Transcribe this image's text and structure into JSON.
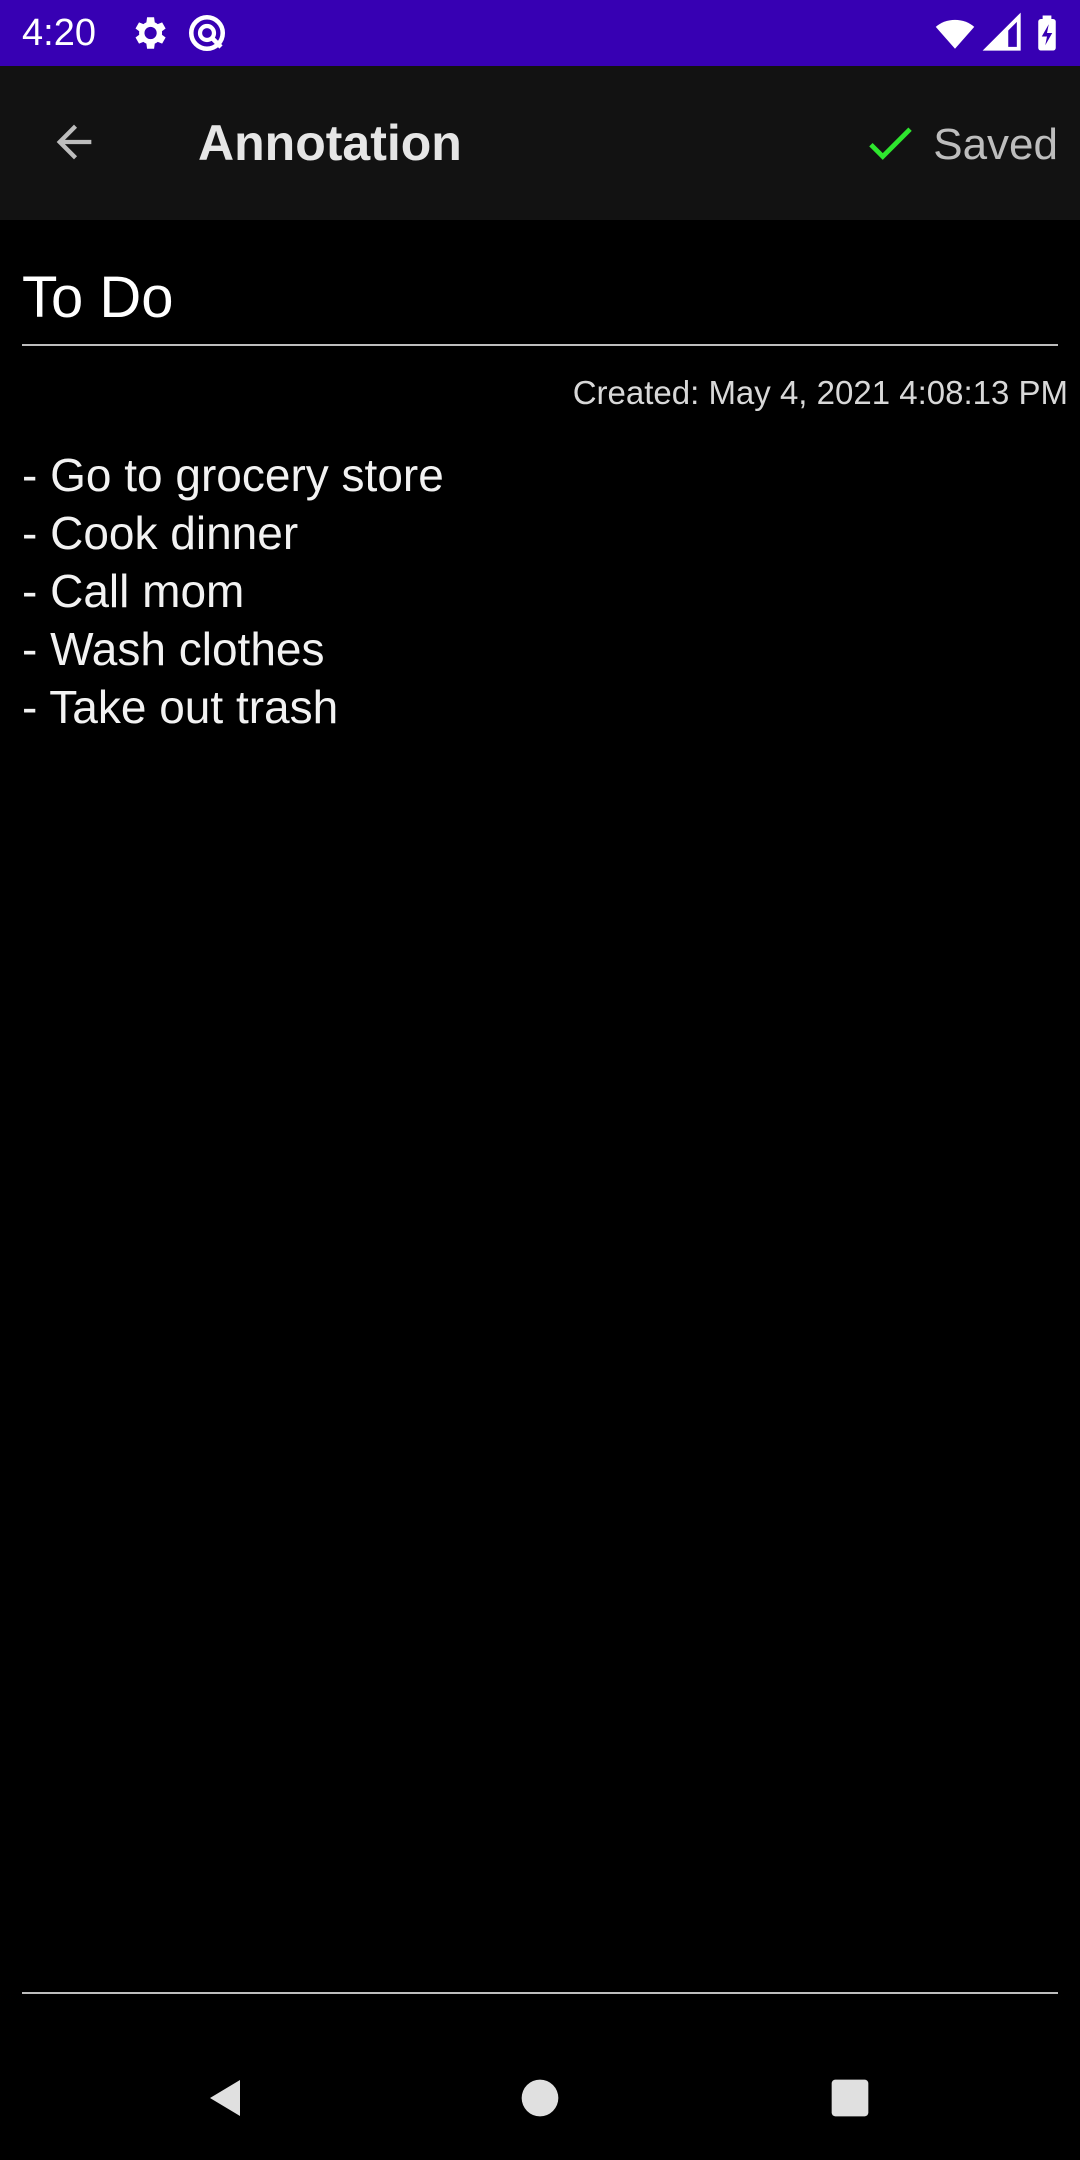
{
  "status_bar": {
    "time": "4:20",
    "left_icons": [
      "settings-gear-icon",
      "data-saver-icon"
    ],
    "right_icons": [
      "wifi-icon",
      "cell-signal-icon",
      "battery-charging-icon"
    ],
    "background_color": "#3700b3"
  },
  "app_bar": {
    "back_icon": "arrow-back-icon",
    "title": "Annotation",
    "saved_icon": "check-icon",
    "saved_label": "Saved",
    "check_color": "#2ee62e"
  },
  "note": {
    "title": "To Do",
    "created": "Created: May 4, 2021 4:08:13 PM",
    "lines": [
      "- Go to grocery store",
      "- Cook dinner",
      "- Call mom",
      "- Wash clothes",
      "- Take out trash"
    ]
  },
  "nav_bar": {
    "icons": [
      "nav-back-icon",
      "nav-home-icon",
      "nav-recents-icon"
    ]
  }
}
